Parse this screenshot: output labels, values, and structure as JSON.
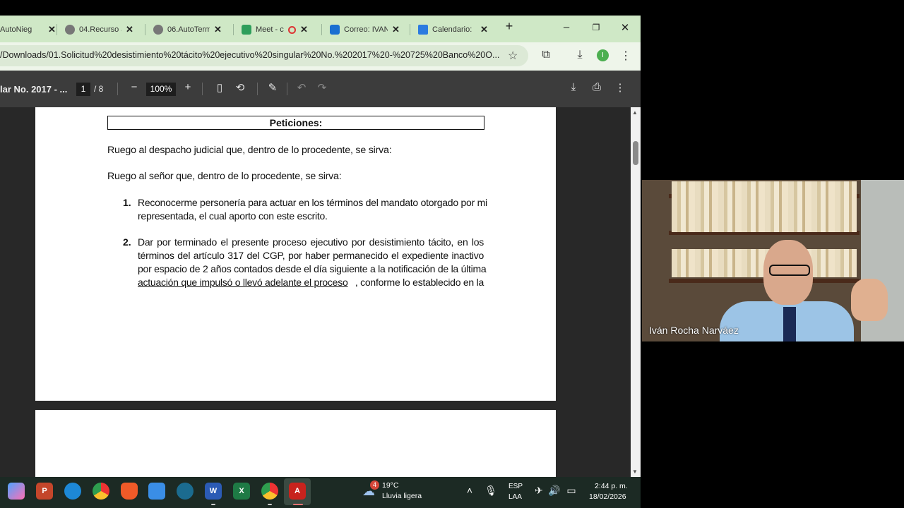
{
  "browser": {
    "tabs": [
      {
        "label": "AutoNieg",
        "icon": "document-icon"
      },
      {
        "label": "04.Recurso a",
        "icon": "globe-icon"
      },
      {
        "label": "06.AutoTerm",
        "icon": "globe-icon"
      },
      {
        "label": "Meet - c",
        "icon": "meet-icon"
      },
      {
        "label": "Correo: IVAN",
        "icon": "outlook-icon"
      },
      {
        "label": "Calendario:",
        "icon": "calendar-icon"
      }
    ],
    "new_tab": "+",
    "url": "/Downloads/01.Solicitud%20desistimiento%20tácito%20ejecutivo%20singular%20No.%202017%20-%20725%20Banco%20O...",
    "profile_initial": "I"
  },
  "pdf_toolbar": {
    "title": "lar No. 2017 - ...",
    "page_current": "1",
    "page_total": "/ 8",
    "zoom": "100%"
  },
  "document": {
    "heading": "Peticiones:",
    "para1": "Ruego al despacho judicial que, dentro de lo procedente, se sirva:",
    "para2": "Ruego al señor que, dentro de lo procedente, se sirva:",
    "items": [
      {
        "num": "1.",
        "lines": [
          "Reconocerme personería para actuar en los términos del mandato otorgado por mi",
          "representada, el cual aporto con este escrito."
        ]
      },
      {
        "num": "2.",
        "lines": [
          "Dar por terminado el presente proceso ejecutivo por desistimiento tácito, en los",
          "términos del artículo 317 del CGP, por haber permanecido el expediente inactivo",
          "por espacio de 2 años contados desde el día siguiente a la notificación de la última"
        ],
        "last_underlined": "actuación que impulsó o llevó adelante el proceso",
        "last_rest": ", conforme lo establecido en la"
      }
    ]
  },
  "video": {
    "participant_name": "Iván Rocha Narváez"
  },
  "taskbar": {
    "weather_temp": "19°C",
    "weather_desc": "Lluvia ligera",
    "weather_badge": "4",
    "lang_top": "ESP",
    "lang_bottom": "LAA",
    "time": "2:44 p. m.",
    "date": "18/02/2026"
  },
  "colors": {
    "tabstrip": "#cfe8c6",
    "pdf_toolbar": "#3c3c3c",
    "viewer_bg": "#282828",
    "taskbar": "#1c2a24"
  }
}
